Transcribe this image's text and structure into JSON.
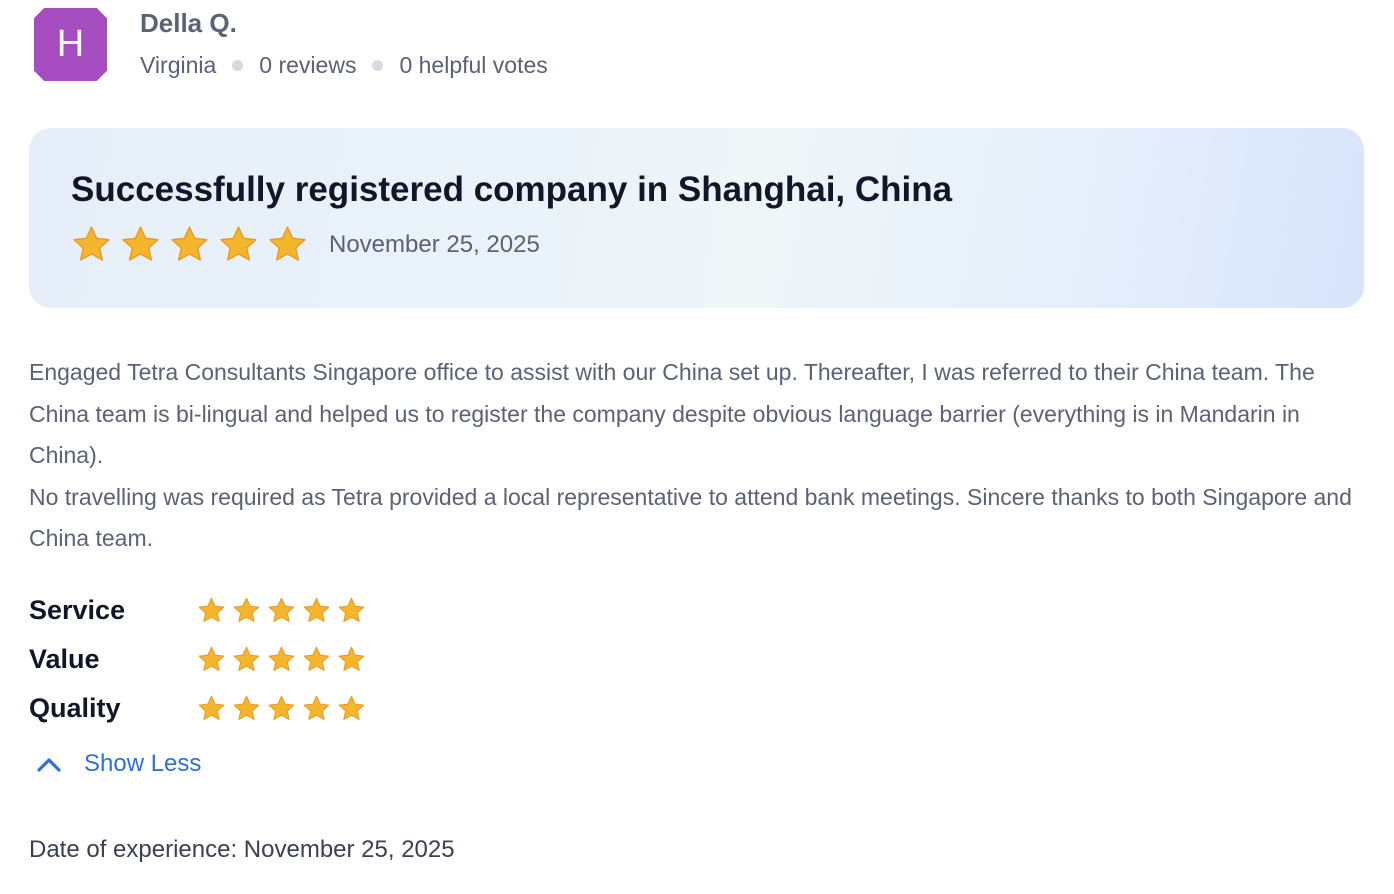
{
  "reviewer": {
    "avatar_letter": "H",
    "avatar_color": "#a44cc0",
    "name": "Della Q.",
    "location": "Virginia",
    "reviews": "0 reviews",
    "helpful_votes": "0 helpful votes"
  },
  "review": {
    "title": "Successfully registered company in Shanghai, China",
    "rating": 5,
    "date": "November 25, 2025",
    "body_paragraph_1": "Engaged Tetra Consultants Singapore office to assist with our China set up. Thereafter, I was referred to their China team. The China team is bi-lingual and helped us to register the company despite obvious language barrier (everything is in Mandarin in China).",
    "body_paragraph_2": "No travelling was required as Tetra provided a local representative to attend bank meetings. Sincere thanks to both Singapore and China team."
  },
  "ratings": [
    {
      "label": "Service",
      "stars": 5
    },
    {
      "label": "Value",
      "stars": 5
    },
    {
      "label": "Quality",
      "stars": 5
    }
  ],
  "show_less": {
    "label": "Show Less",
    "icon": "chevron-up-icon"
  },
  "experience": {
    "text": "Date of experience: November 25, 2025"
  },
  "colors": {
    "star_fill": "#f5b52c",
    "link": "#2f6fde",
    "muted_text": "#5b6275"
  }
}
